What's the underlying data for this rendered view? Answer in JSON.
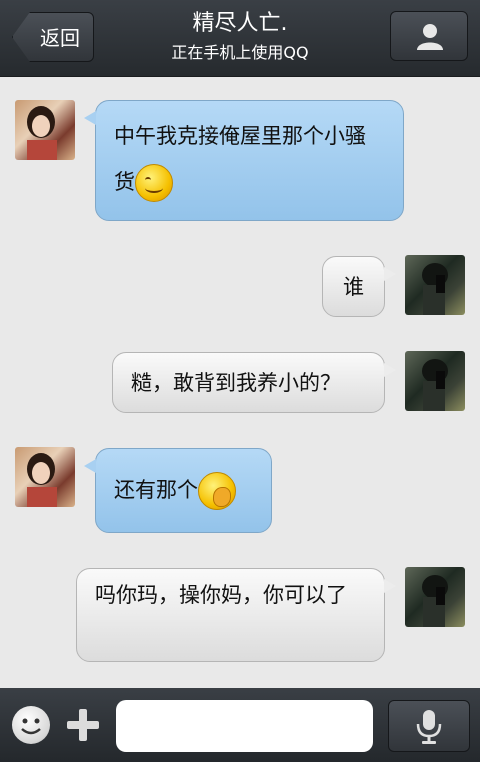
{
  "header": {
    "back_label": "返回",
    "title": "精尽人亡.",
    "subtitle": "正在手机上使用QQ",
    "profile_icon": "person-icon"
  },
  "messages": [
    {
      "side": "left",
      "text": "中午我克接俺屋里那个小骚货",
      "emoji": "smile"
    },
    {
      "side": "right",
      "text": "谁"
    },
    {
      "side": "right",
      "text": "糙，敢背到我养小的？"
    },
    {
      "side": "left",
      "text": "还有那个",
      "emoji": "hand-over-mouth"
    },
    {
      "side": "right",
      "text": "吗你玛，操你妈，你可以了"
    }
  ],
  "input": {
    "placeholder": "",
    "value": ""
  },
  "icons": {
    "emoji_button": "emoji-icon",
    "plus_button": "plus-icon",
    "mic_button": "microphone-icon"
  },
  "colors": {
    "header_bg": "#2f3338",
    "chat_bg": "#e9e9e9",
    "incoming_bubble": "#a8d0f1",
    "outgoing_bubble": "#ececec"
  }
}
